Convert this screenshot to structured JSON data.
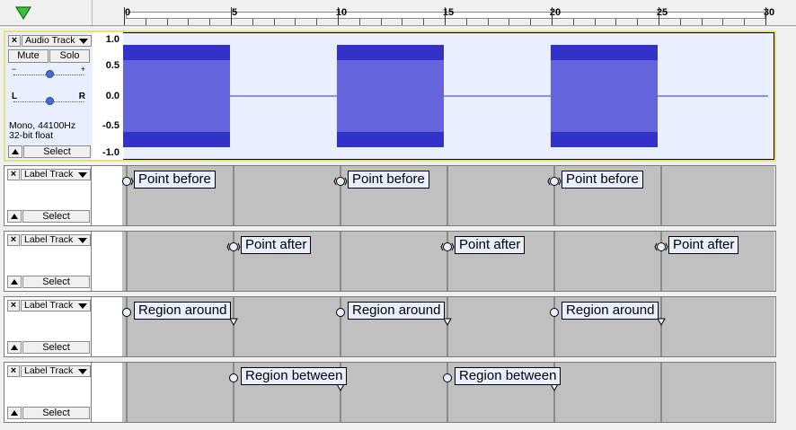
{
  "ruler": {
    "ticks": [
      "0",
      "5",
      "10",
      "15",
      "20",
      "25",
      "30"
    ]
  },
  "audio_track": {
    "close_label": "×",
    "name": "Audio Track",
    "mute_label": "Mute",
    "solo_label": "Solo",
    "gain_min": "−",
    "gain_max": "+",
    "pan_left": "L",
    "pan_right": "R",
    "format_line1": "Mono, 44100Hz",
    "format_line2": "32-bit float",
    "select_label": "Select",
    "scale": [
      "1.0",
      "0.5",
      "0.0",
      "-0.5",
      "-1.0"
    ],
    "clips_seconds": [
      [
        0,
        5
      ],
      [
        10,
        15
      ],
      [
        20,
        25
      ]
    ]
  },
  "label_tracks": [
    {
      "name": "Label Track",
      "select_label": "Select",
      "close_label": "×",
      "labels": [
        {
          "text": "Point before",
          "t0": 0,
          "t1": 0
        },
        {
          "text": "Point before",
          "t0": 10,
          "t1": 10
        },
        {
          "text": "Point before",
          "t0": 20,
          "t1": 20
        }
      ]
    },
    {
      "name": "Label Track",
      "select_label": "Select",
      "close_label": "×",
      "labels": [
        {
          "text": "Point after",
          "t0": 5,
          "t1": 5
        },
        {
          "text": "Point after",
          "t0": 15,
          "t1": 15
        },
        {
          "text": "Point after",
          "t0": 25,
          "t1": 25
        }
      ]
    },
    {
      "name": "Label Track",
      "select_label": "Select",
      "close_label": "×",
      "labels": [
        {
          "text": "Region around",
          "t0": 0,
          "t1": 5
        },
        {
          "text": "Region around",
          "t0": 10,
          "t1": 15
        },
        {
          "text": "Region around",
          "t0": 20,
          "t1": 25
        }
      ]
    },
    {
      "name": "Label Track",
      "select_label": "Select",
      "close_label": "×",
      "labels": [
        {
          "text": "Region between",
          "t0": 5,
          "t1": 10
        },
        {
          "text": "Region between",
          "t0": 15,
          "t1": 20
        }
      ]
    }
  ],
  "colors": {
    "waveform_outer": "#3232c8",
    "waveform_inner": "#6464dc",
    "label_fill": "#e8f0ff",
    "selection_border": "#e8e07a"
  }
}
